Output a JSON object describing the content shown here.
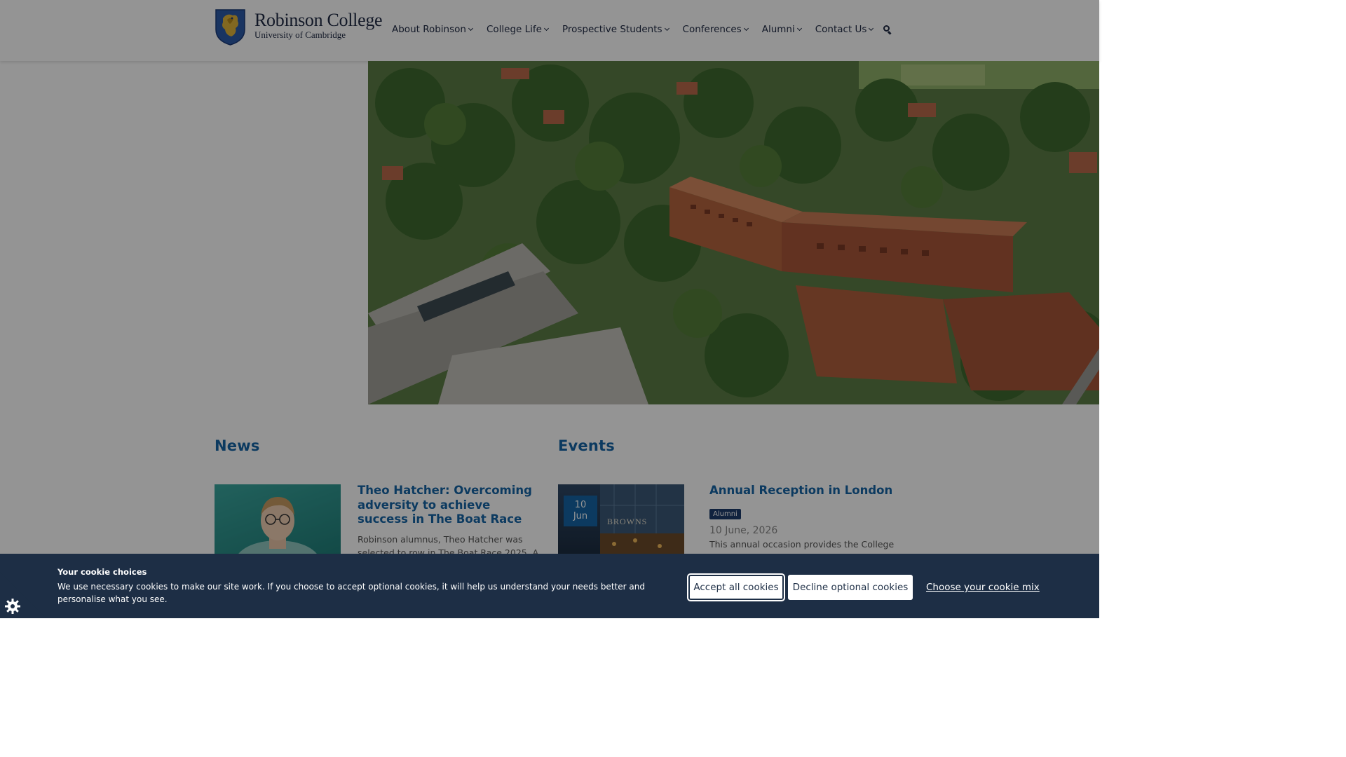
{
  "header": {
    "logo": {
      "title": "Robinson College",
      "subtitle": "University of Cambridge"
    },
    "nav": [
      {
        "label": "About Robinson"
      },
      {
        "label": "College Life"
      },
      {
        "label": "Prospective Students"
      },
      {
        "label": "Conferences"
      },
      {
        "label": "Alumni"
      },
      {
        "label": "Contact Us"
      }
    ],
    "search_icon": "search-icon"
  },
  "hero": {
    "image": "aerial-view-of-college"
  },
  "news": {
    "heading": "News",
    "item": {
      "title": "Theo Hatcher: Overcoming adversity to achieve success in The Boat Race",
      "excerpt": "Robinson alumnus, Theo Hatcher was selected to row in The Boat Race 2025. A"
    }
  },
  "events": {
    "heading": "Events",
    "item": {
      "badge_day": "10",
      "badge_month": "Jun",
      "thumb_text": "BROWNS",
      "title": "Annual Reception in London",
      "tag": "Alumni",
      "date": "10 June, 2026",
      "excerpt": "This annual occasion provides the College"
    }
  },
  "cookie": {
    "title": "Your cookie choices",
    "text": "We use necessary cookies to make our site work. If you choose to accept optional cookies, it will help us understand your needs better and personalise what you see.",
    "accept_label": "Accept all cookies",
    "decline_label": "Decline optional cookies",
    "mix_label": "Choose your cookie mix",
    "settings_icon": "gear-icon"
  },
  "colors": {
    "brand_blue": "#1565a6",
    "navy": "#1f2a44",
    "banner": "#1d2e45",
    "tag": "#1d3b6b"
  }
}
